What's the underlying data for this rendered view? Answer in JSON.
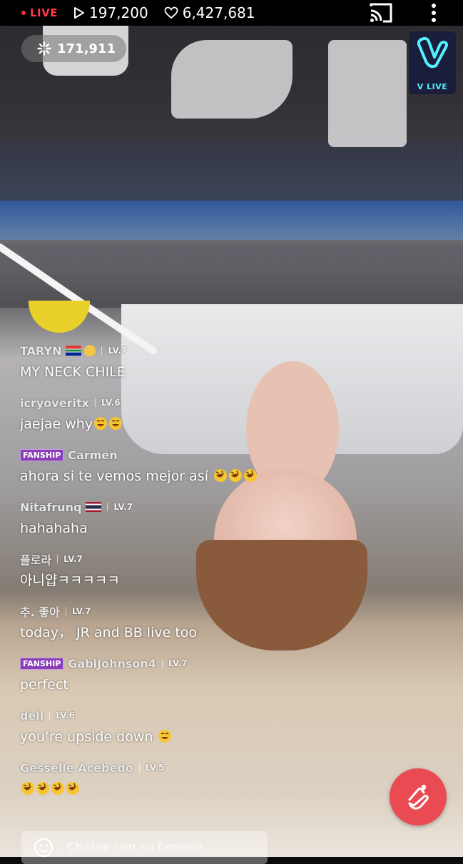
{
  "status_bar": {
    "live_label": "LIVE",
    "play_count": "197,200",
    "like_count": "6,427,681"
  },
  "viewer_count": "171,911",
  "logo_label": "V LIVE",
  "chat": [
    {
      "user": "TARYN",
      "flags": [
        "south-africa-flag",
        "hands-emoji"
      ],
      "level": "LV.7",
      "text": "MY NECK CHILE",
      "emojis": [],
      "fanship": false
    },
    {
      "user": "icryoveritx",
      "flags": [],
      "level": "LV.6",
      "text": "jaejae why",
      "emojis": [
        "grinning-sweat",
        "grinning-sweat"
      ],
      "fanship": false
    },
    {
      "user": "Carmen",
      "flags": [],
      "level": "",
      "text": "ahora si te vemos mejor así ",
      "emojis": [
        "rofl",
        "rofl",
        "rofl"
      ],
      "fanship": true
    },
    {
      "user": "Nitafrunq",
      "flags": [
        "thailand-flag"
      ],
      "level": "LV.7",
      "text": "hahahaha",
      "emojis": [],
      "fanship": false
    },
    {
      "user": "플로라",
      "flags": [],
      "level": "LV.7",
      "text": "아니얍ㅋㅋㅋㅋㅋ",
      "emojis": [],
      "fanship": false
    },
    {
      "user": "추. 좋아",
      "flags": [],
      "level": "LV.7",
      "text": "today， JR and BB live too",
      "emojis": [],
      "fanship": false
    },
    {
      "user": "GabiJohnson4",
      "flags": [],
      "level": "LV.7",
      "text": "perfect",
      "emojis": [],
      "fanship": true
    },
    {
      "user": "dell",
      "flags": [],
      "level": "LV.6",
      "text": "you’re upside down ",
      "emojis": [
        "grinning-sweat"
      ],
      "fanship": false
    },
    {
      "user": "Gesselle Acebedo",
      "flags": [],
      "level": "LV.5",
      "text": "",
      "emojis": [
        "rofl",
        "rofl",
        "rofl",
        "rofl"
      ],
      "fanship": false
    }
  ],
  "fanship_label": "FANSHIP",
  "chat_input": {
    "placeholder": "Chatee con su famoso."
  },
  "colors": {
    "live_red": "#ff3a4a",
    "heart_button": "#ea4b52",
    "fanship_badge": "#8a3fb8",
    "logo_accent": "#53f0ff"
  }
}
